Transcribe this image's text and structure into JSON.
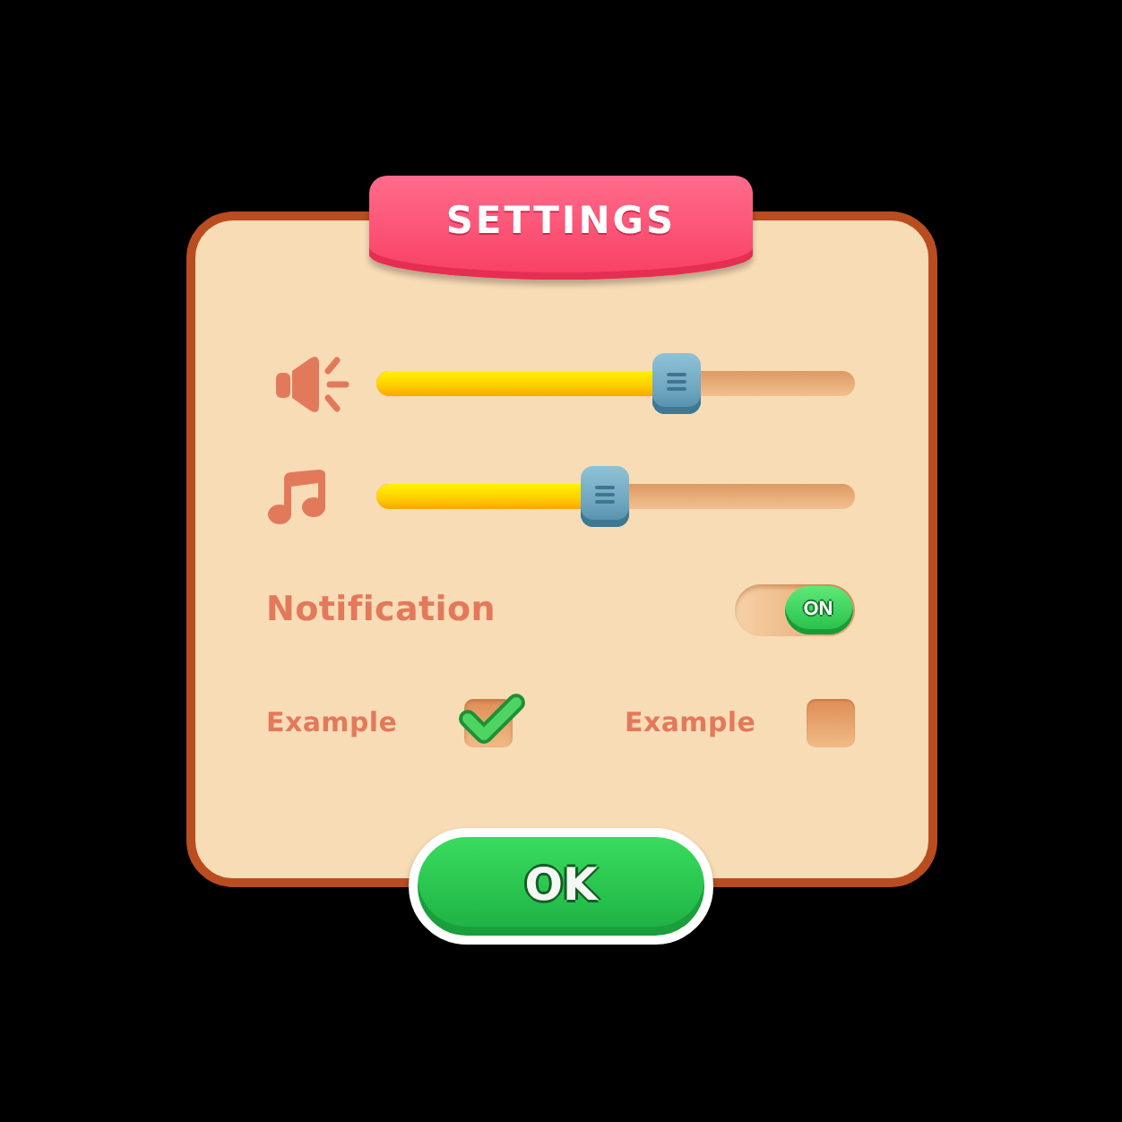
{
  "title": "SETTINGS",
  "sliders": [
    {
      "kind": "volume",
      "level": 0.63
    },
    {
      "kind": "music",
      "level": 0.48
    }
  ],
  "notification": {
    "label": "Notification",
    "on": true,
    "toggle_text": "ON"
  },
  "examples": [
    {
      "label": "Example",
      "checked": true
    },
    {
      "label": "Example",
      "checked": false
    }
  ],
  "ok_button": {
    "label": "OK"
  }
}
